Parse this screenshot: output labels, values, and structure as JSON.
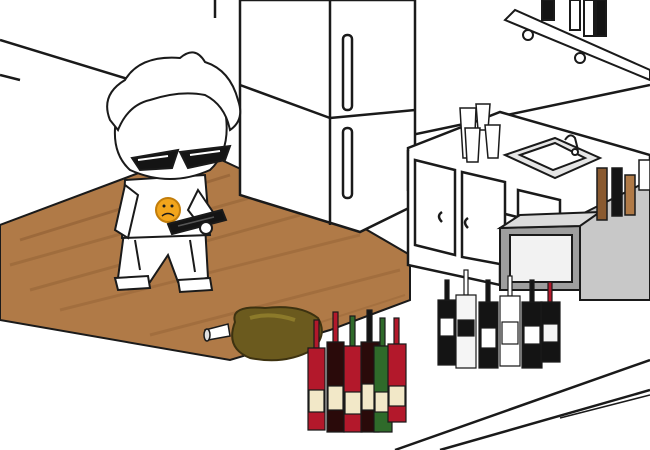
{
  "scene": {
    "kind": "game-scene",
    "colors": {
      "background": "#ffffff",
      "outline": "#1a1a1a",
      "wood": "#b07a47",
      "wood_dark": "#8a5a30",
      "spill": "#6b5a1e",
      "steel": "#c8c8c8",
      "counter_dark": "#9e9e9e",
      "shirt_emblem": "#f2a51c",
      "wine_red": "#b3182b",
      "wine_green": "#2f6a2a",
      "liquor_black": "#141414"
    },
    "character": {
      "hair": "white",
      "glasses": "pointed-shades-icon",
      "emblem": "frowny-face-icon",
      "holding": "phone-icon"
    },
    "props": [
      "refrigerator-icon",
      "kitchen-sink-icon",
      "cabinet-icon",
      "paper-cup-stack-icon",
      "wine-bottle-icon",
      "liquor-bottle-icon",
      "spilled-puddle-icon",
      "knocked-over-cup-icon",
      "wall-shelf-icon"
    ]
  }
}
